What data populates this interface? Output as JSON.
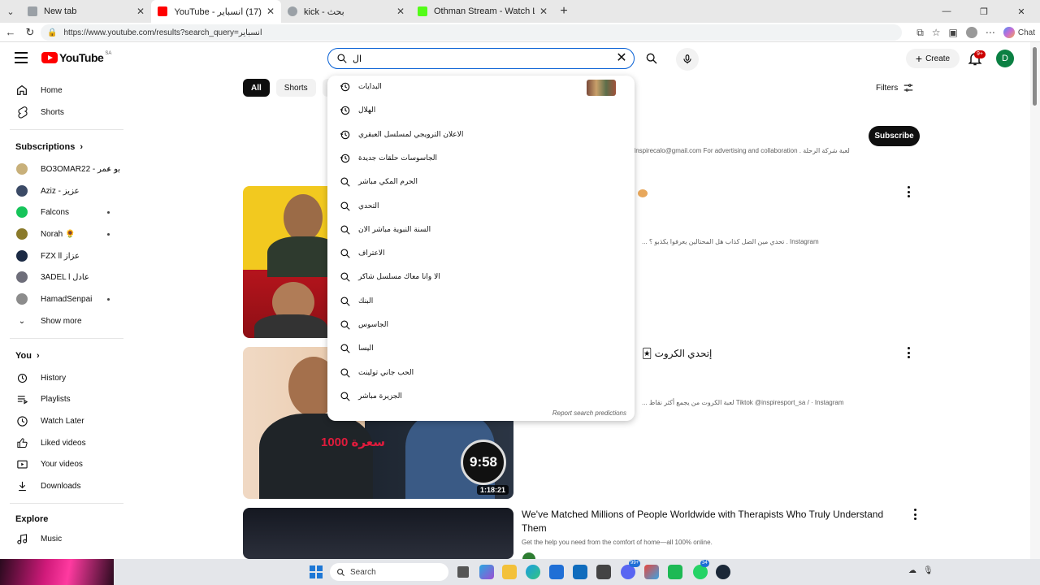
{
  "browser": {
    "tabs": [
      {
        "title": "New tab",
        "active": false,
        "favicon_color": "#9aa0a6"
      },
      {
        "title": "(17) انسباير - YouTube",
        "active": true,
        "favicon_color": "#ff0000"
      },
      {
        "title": "kick - بحث",
        "active": false,
        "favicon_color": "#9aa0a6"
      },
      {
        "title": "Othman Stream - Watch Live on Kick",
        "active": false,
        "favicon_color": "#53fc18"
      }
    ],
    "url": "https://www.youtube.com/results?search_query=انسباير",
    "chat_label": "Chat"
  },
  "header": {
    "logo_text": "YouTube",
    "logo_country": "SA",
    "search_value": "ال",
    "create_label": "Create",
    "notif_count": "9+",
    "user_initial": "D"
  },
  "sidebar": {
    "main": [
      {
        "label": "Home",
        "icon": "home-icon"
      },
      {
        "label": "Shorts",
        "icon": "shorts-icon"
      }
    ],
    "subscriptions_heading": "Subscriptions",
    "subscriptions": [
      {
        "label": "BO3OMAR22 - بو عمر",
        "color": "#c8b07a",
        "dot": true
      },
      {
        "label": "Aziz - عزيز",
        "color": "#3b4a66",
        "dot": false
      },
      {
        "label": "Falcons",
        "color": "#16c45a",
        "dot": true
      },
      {
        "label": "Norah 🌻",
        "color": "#8a7a2a",
        "dot": true
      },
      {
        "label": "FZX ll عزاز",
        "color": "#1b2a44",
        "dot": false
      },
      {
        "label": "3ADEL l عادل",
        "color": "#6e6e7a",
        "dot": false
      },
      {
        "label": "HamadSenpai",
        "color": "#8c8c8c",
        "dot": true
      }
    ],
    "show_more": "Show more",
    "you_heading": "You",
    "you_items": [
      {
        "label": "History",
        "icon": "history-icon"
      },
      {
        "label": "Playlists",
        "icon": "playlists-icon"
      },
      {
        "label": "Watch Later",
        "icon": "watch-later-icon"
      },
      {
        "label": "Liked videos",
        "icon": "thumbs-up-icon"
      },
      {
        "label": "Your videos",
        "icon": "your-videos-icon"
      },
      {
        "label": "Downloads",
        "icon": "download-icon"
      }
    ],
    "explore_heading": "Explore",
    "explore_items": [
      {
        "label": "Music",
        "icon": "music-icon"
      }
    ]
  },
  "chips": [
    {
      "label": "All",
      "active": true
    },
    {
      "label": "Shorts",
      "active": false
    },
    {
      "label": "Vid",
      "active": false
    }
  ],
  "filters_label": "Filters",
  "channel": {
    "subscribe_label": "Subscribe",
    "description": "لعبة شركة الرحلة . Inspirecalo@gmail.com For advertising and collaboration"
  },
  "videos": [
    {
      "title": "",
      "snippet": "Instagram . تحدي مين الضل كذاب هل المحتالين يعرفوا يكذبو ؟ ...",
      "duration": ""
    },
    {
      "title": "إتحدي الكروت 🃏",
      "snippet": "Tiktok @inspiresport_sa / · Instagram لعبة الكروت من يجمع أكثر نقاط ...",
      "duration": "1:18:21",
      "timer": "9:58",
      "thumb_text": "سعرة 1000"
    },
    {
      "title": "We've Matched Millions of People Worldwide with Therapists Who Truly Understand Them",
      "snippet": "Get the help you need from the comfort of home—all 100% online.",
      "duration": ""
    }
  ],
  "suggestions": [
    {
      "text": "البدايات",
      "type": "history",
      "has_thumb": true
    },
    {
      "text": "الهلال",
      "type": "history",
      "has_thumb": false
    },
    {
      "text": "الاعلان الترويجي لمسلسل العبقري",
      "type": "history",
      "has_thumb": false
    },
    {
      "text": "الجاسوسات حلقات جديدة",
      "type": "history",
      "has_thumb": false
    },
    {
      "text": "الحرم المكي مباشر",
      "type": "search",
      "has_thumb": false
    },
    {
      "text": "التحدي",
      "type": "search",
      "has_thumb": false
    },
    {
      "text": "السنة النبوية مباشر الان",
      "type": "search",
      "has_thumb": false
    },
    {
      "text": "الاعتراف",
      "type": "search",
      "has_thumb": false
    },
    {
      "text": "الا وانا معاك مسلسل شاكر",
      "type": "search",
      "has_thumb": false
    },
    {
      "text": "البنك",
      "type": "search",
      "has_thumb": false
    },
    {
      "text": "الجاسوس",
      "type": "search",
      "has_thumb": false
    },
    {
      "text": "اليسا",
      "type": "search",
      "has_thumb": false
    },
    {
      "text": "الحب جاني تولينت",
      "type": "search",
      "has_thumb": false
    },
    {
      "text": "الجزيرة مباشر",
      "type": "search",
      "has_thumb": false
    }
  ],
  "report_label": "Report search predictions",
  "taskbar": {
    "search_label": "Search",
    "badges": [
      "99+",
      "34"
    ]
  },
  "colors": {
    "brand_red": "#ff0000",
    "search_border": "#065fd4",
    "chip_active": "#0f0f0f",
    "avatar_green": "#0b8043"
  }
}
